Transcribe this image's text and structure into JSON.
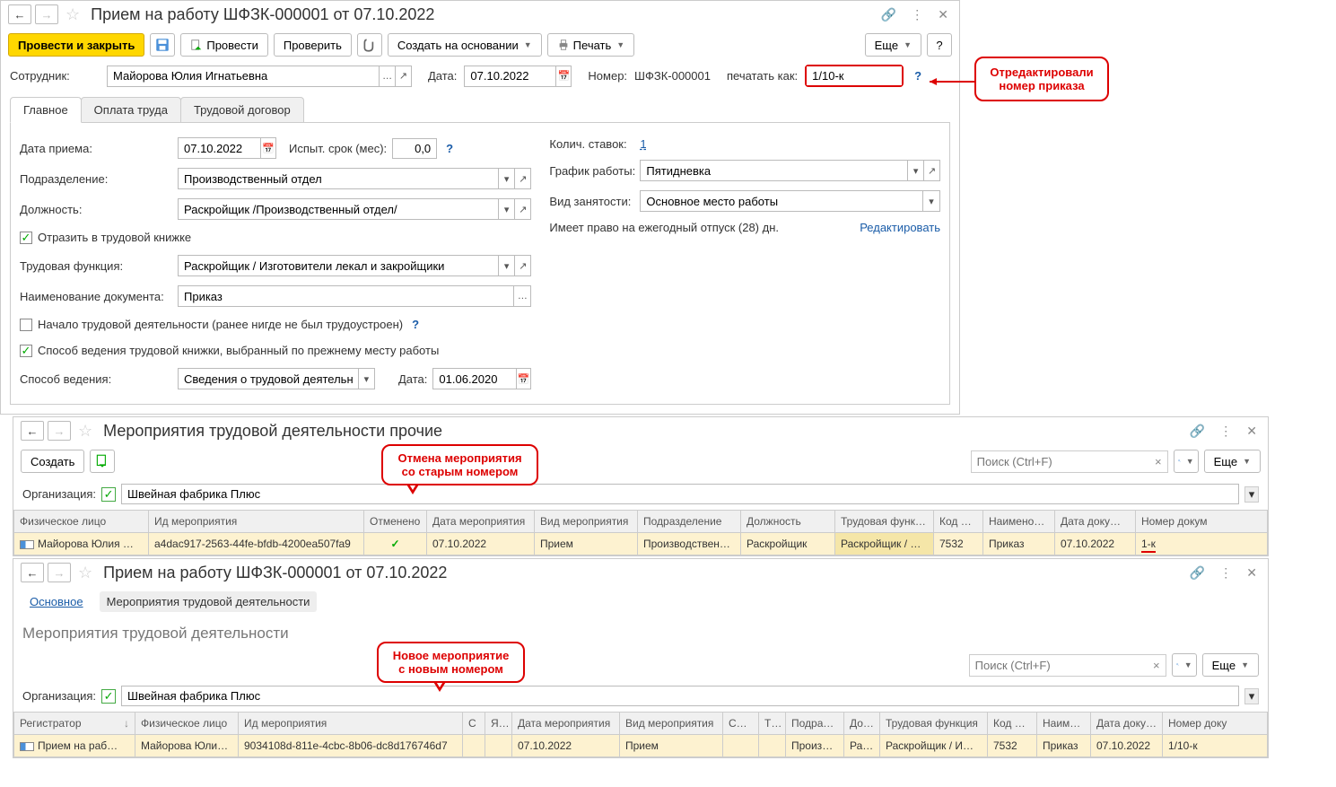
{
  "window1": {
    "title": "Прием на работу ШФЗК-000001 от 07.10.2022",
    "toolbar": {
      "post_close": "Провести и закрыть",
      "post": "Провести",
      "check": "Проверить",
      "create_based": "Создать на основании",
      "print": "Печать",
      "more": "Еще"
    },
    "header": {
      "employee_label": "Сотрудник:",
      "employee": "Майорова Юлия Игнатьевна",
      "date_label": "Дата:",
      "date": "07.10.2022",
      "number_label": "Номер:",
      "number": "ШФЗК-000001",
      "print_as_label": "печатать как:",
      "print_as": "1/10-к"
    },
    "tabs": {
      "main": "Главное",
      "pay": "Оплата труда",
      "contract": "Трудовой договор"
    },
    "main_form": {
      "hire_date_label": "Дата приема:",
      "hire_date": "07.10.2022",
      "probation_label": "Испыт. срок (мес):",
      "probation": "0,0",
      "rates_label": "Колич. ставок:",
      "rates": "1",
      "department_label": "Подразделение:",
      "department": "Производственный отдел",
      "schedule_label": "График работы:",
      "schedule": "Пятидневка",
      "position_label": "Должность:",
      "position": "Раскройщик /Производственный отдел/",
      "employment_type_label": "Вид занятости:",
      "employment_type": "Основное место работы",
      "workbook_cb": "Отразить в трудовой книжке",
      "vacation_text": "Имеет право на ежегодный отпуск (28) дн.",
      "edit_link": "Редактировать",
      "function_label": "Трудовая функция:",
      "function": "Раскройщик / Изготовители лекал и закройщики",
      "docname_label": "Наименование документа:",
      "docname": "Приказ",
      "first_job_cb": "Начало трудовой деятельности (ранее нигде не был трудоустроен)",
      "record_method_cb": "Способ ведения трудовой книжки, выбранный по прежнему месту работы",
      "method_label": "Способ ведения:",
      "method": "Сведения о трудовой деятельности в",
      "method_date_label": "Дата:",
      "method_date": "01.06.2020"
    },
    "annotation1": "Отредактировали номер приказа"
  },
  "window2": {
    "title": "Мероприятия трудовой деятельности прочие",
    "create_btn": "Создать",
    "more": "Еще",
    "search_placeholder": "Поиск (Ctrl+F)",
    "org_label": "Организация:",
    "org": "Швейная фабрика Плюс",
    "annotation": "Отмена мероприятия со старым номером",
    "columns": {
      "c1": "Физическое лицо",
      "c2": "Ид мероприятия",
      "c3": "Отменено",
      "c4": "Дата мероприятия",
      "c5": "Вид мероприятия",
      "c6": "Подразделение",
      "c7": "Должность",
      "c8": "Трудовая функ…",
      "c9": "Код п…",
      "c10": "Наименов…",
      "c11": "Дата доку…",
      "c12": "Номер докум"
    },
    "row": {
      "c1": "Майорова Юлия …",
      "c2": "a4dac917-2563-44fe-bfdb-4200ea507fa9",
      "c4": "07.10.2022",
      "c5": "Прием",
      "c6": "Производствен…",
      "c7": "Раскройщик",
      "c8": "Раскройщик / …",
      "c9": "7532",
      "c10": "Приказ",
      "c11": "07.10.2022",
      "c12": "1-к"
    }
  },
  "window3": {
    "title": "Прием на работу ШФЗК-000001 от 07.10.2022",
    "bc1": "Основное",
    "bc2": "Мероприятия трудовой деятельности",
    "section": "Мероприятия трудовой деятельности",
    "more": "Еще",
    "search_placeholder": "Поиск (Ctrl+F)",
    "org_label": "Организация:",
    "org": "Швейная фабрика Плюс",
    "annotation": "Новое мероприятие с новым номером",
    "columns": {
      "c1": "Регистратор",
      "c1s": "↓",
      "c2": "Физическое лицо",
      "c3": "Ид мероприятия",
      "c4": "С",
      "c5": "Я…",
      "c6": "Дата мероприятия",
      "c7": "Вид мероприятия",
      "c8": "Св…",
      "c9": "Т…",
      "c10": "Подраз…",
      "c11": "До…",
      "c12": "Трудовая функция",
      "c13": "Код п…",
      "c14": "Наиме…",
      "c15": "Дата доку…",
      "c16": "Номер доку"
    },
    "row": {
      "c1": "Прием на раб…",
      "c2": "Майорова Юли…",
      "c3": "9034108d-811e-4cbc-8b06-dc8d176746d7",
      "c6": "07.10.2022",
      "c7": "Прием",
      "c10": "Произв…",
      "c11": "Ра…",
      "c12": "Раскройщик / И…",
      "c13": "7532",
      "c14": "Приказ",
      "c15": "07.10.2022",
      "c16": "1/10-к"
    }
  }
}
